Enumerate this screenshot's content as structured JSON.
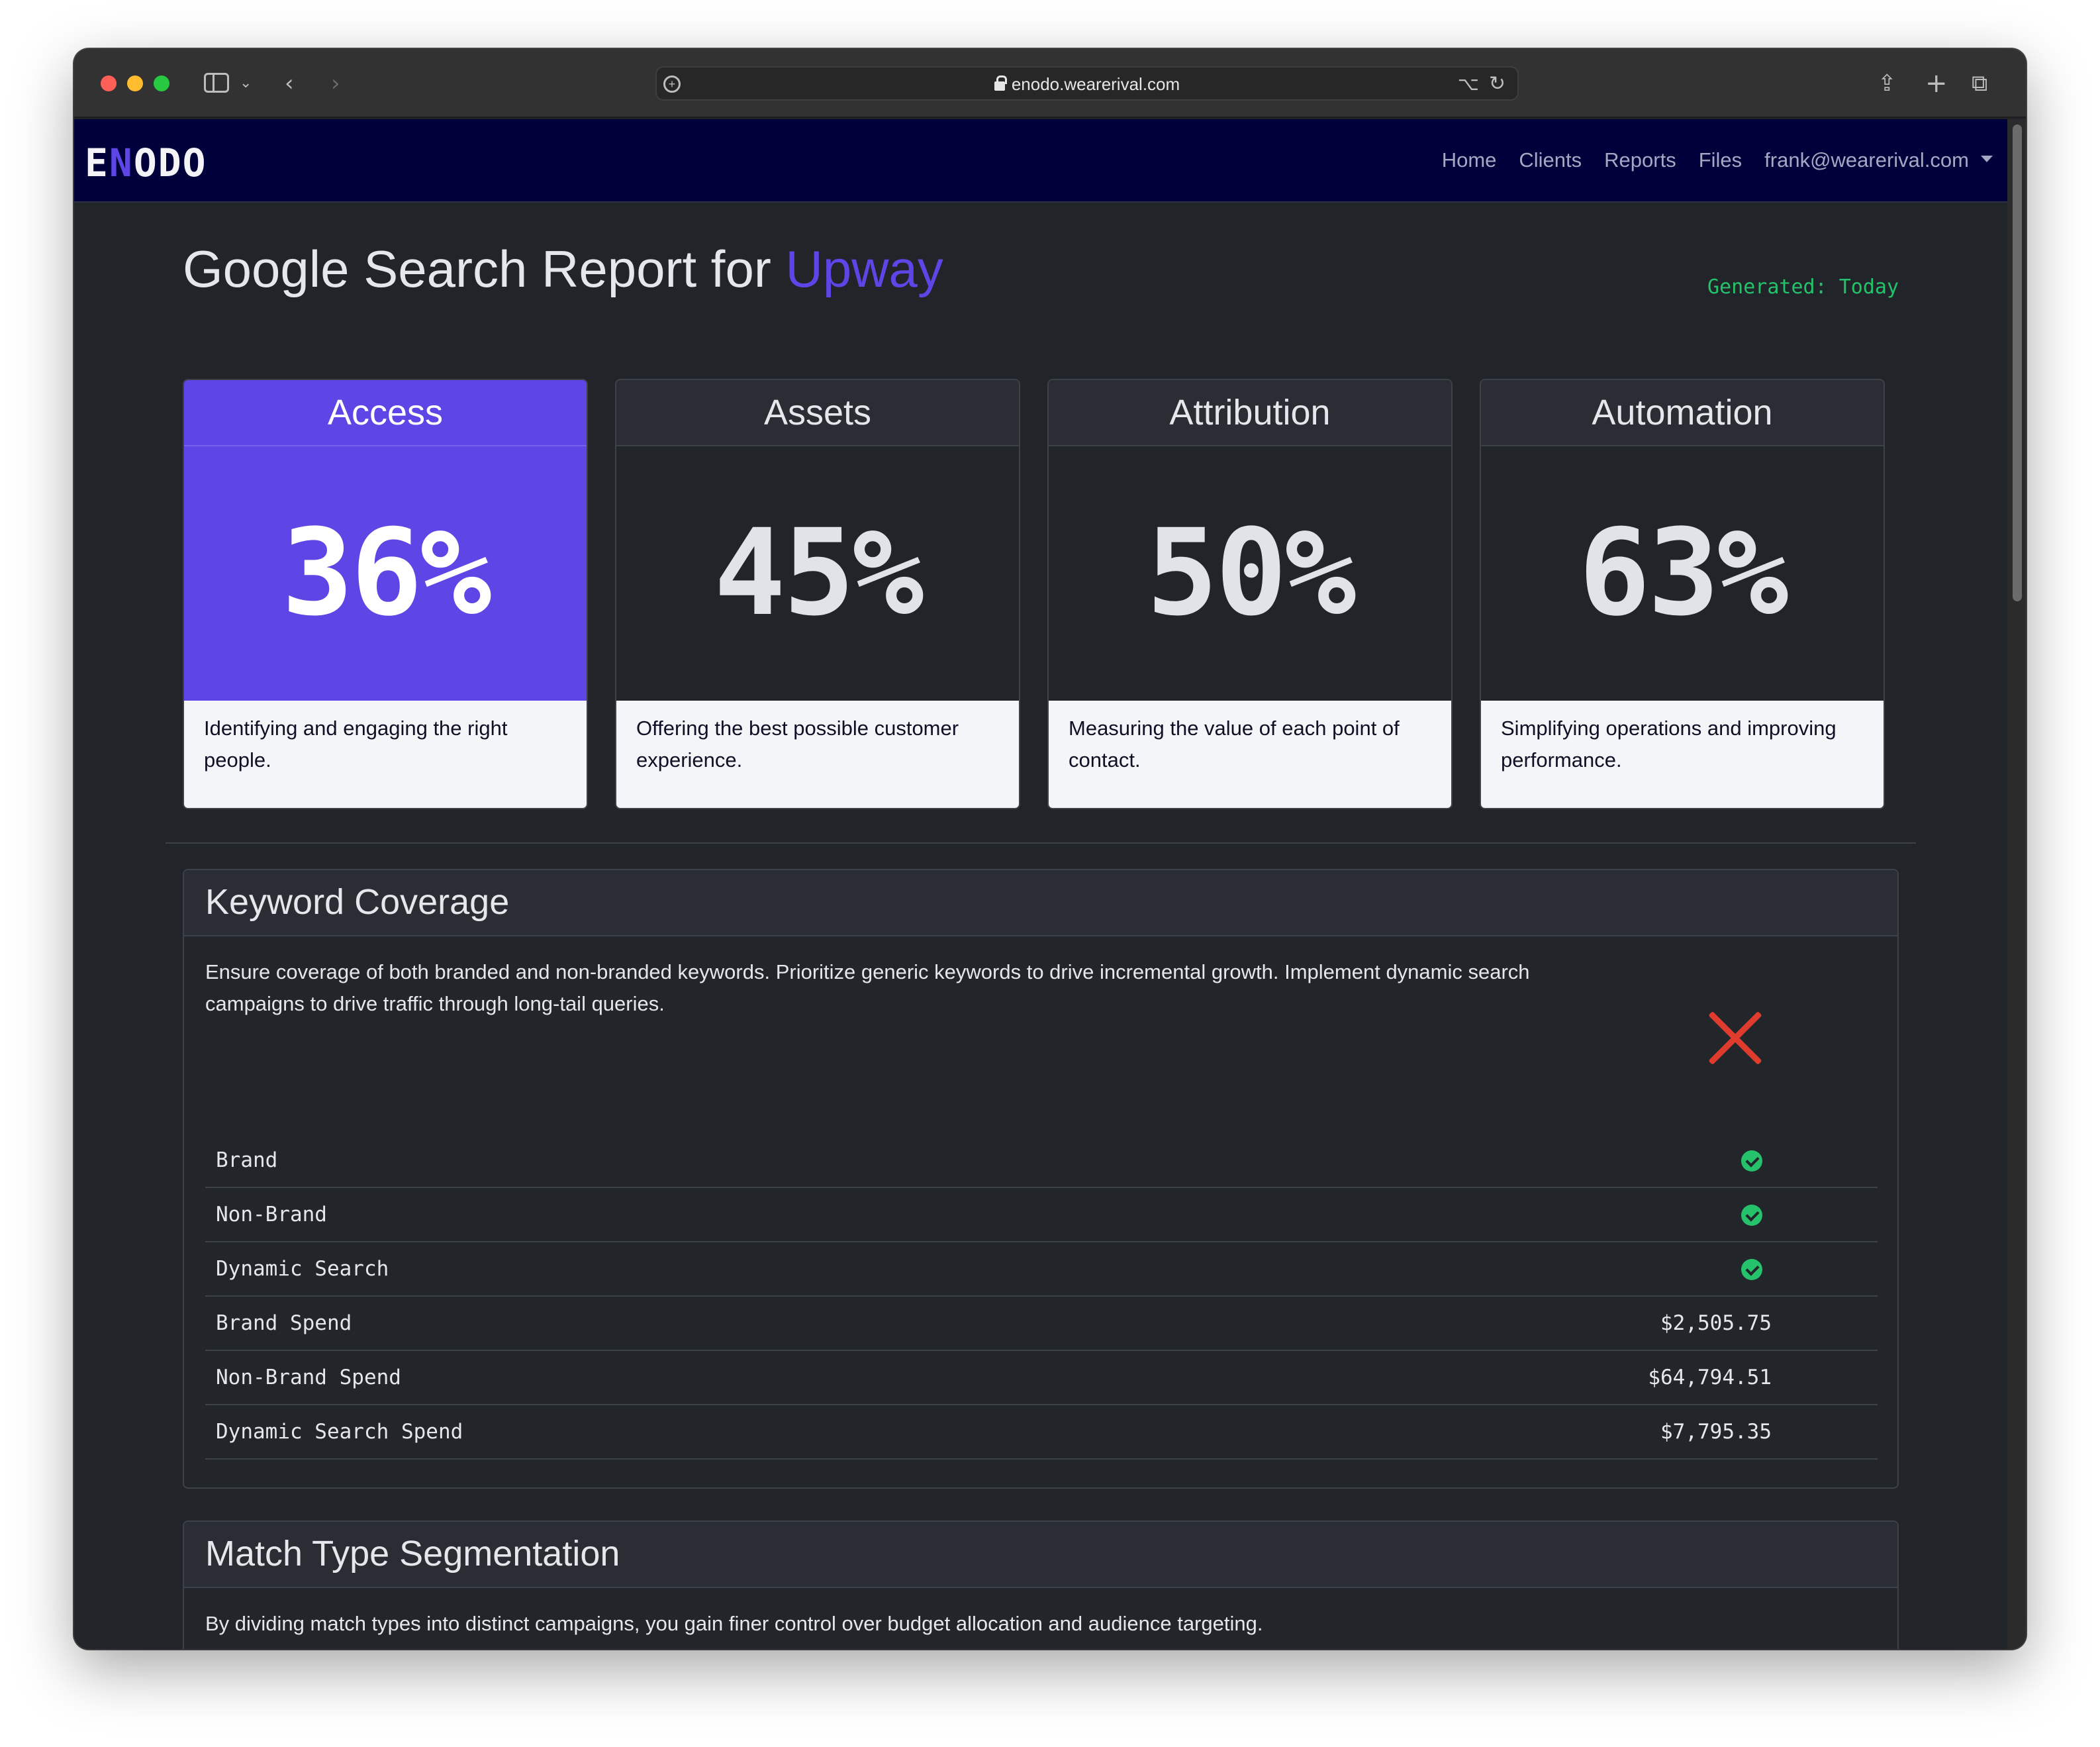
{
  "browser": {
    "url": "enodo.wearerival.com"
  },
  "navbar": {
    "brand_prefix": "E",
    "brand_accent": "N",
    "brand_suffix": "ODO",
    "links": [
      "Home",
      "Clients",
      "Reports",
      "Files"
    ],
    "user": "frank@wearerival.com"
  },
  "report": {
    "title_prefix": "Google Search Report for",
    "client": "Upway",
    "generated": "Generated: Today"
  },
  "cards": [
    {
      "title": "Access",
      "value": "36%",
      "description": "Identifying and engaging the right people."
    },
    {
      "title": "Assets",
      "value": "45%",
      "description": "Offering the best possible customer experience."
    },
    {
      "title": "Attribution",
      "value": "50%",
      "description": "Measuring the value of each point of contact."
    },
    {
      "title": "Automation",
      "value": "63%",
      "description": "Simplifying operations and improving performance."
    }
  ],
  "keyword_coverage": {
    "title": "Keyword Coverage",
    "description": "Ensure coverage of both branded and non-branded keywords. Prioritize generic keywords to drive incremental growth. Implement dynamic search campaigns to drive traffic through long-tail queries.",
    "rows": [
      {
        "label": "Brand",
        "value": ""
      },
      {
        "label": "Non-Brand",
        "value": ""
      },
      {
        "label": "Dynamic Search",
        "value": ""
      },
      {
        "label": "Brand Spend",
        "value": "$2,505.75"
      },
      {
        "label": "Non-Brand Spend",
        "value": "$64,794.51"
      },
      {
        "label": "Dynamic Search Spend",
        "value": "$7,795.35"
      }
    ]
  },
  "match_type": {
    "title": "Match Type Segmentation",
    "description": "By dividing match types into distinct campaigns, you gain finer control over budget allocation and audience targeting."
  },
  "colors": {
    "accent": "#5d45e6",
    "navbar": "#00003a",
    "background": "#212429",
    "success": "#26c26b",
    "danger": "#e03c2e"
  },
  "icons": [
    "site-settings-icon",
    "lock-icon",
    "translate-icon",
    "reload-icon",
    "share-icon",
    "new-tab-icon",
    "tabs-overview-icon",
    "check-circle-icon",
    "x-mark-icon"
  ]
}
